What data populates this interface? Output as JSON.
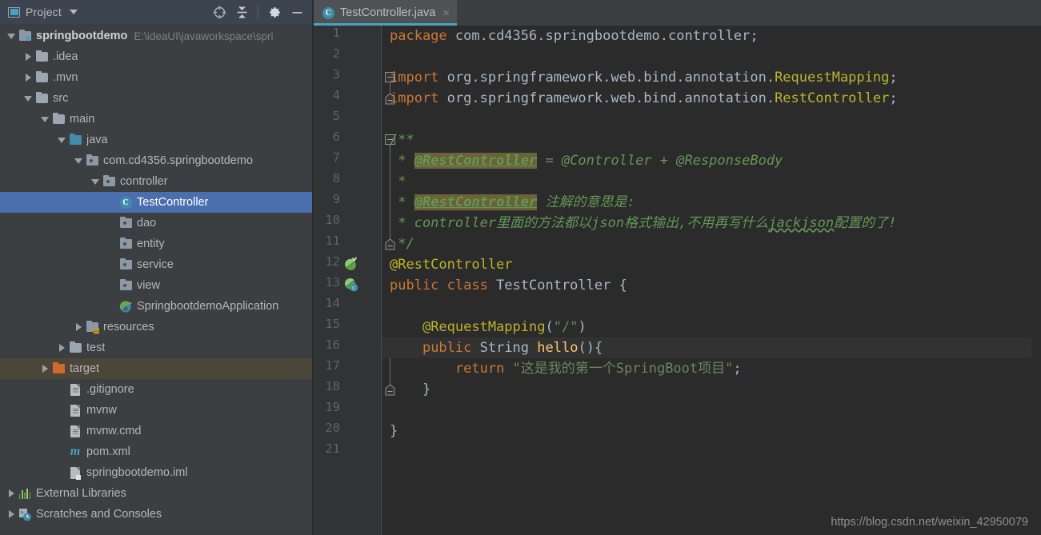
{
  "app": {
    "theme_bg": "#3c3f41",
    "editor_bg": "#2b2b2b",
    "accent": "#4b6eaf"
  },
  "project_panel": {
    "title": "Project",
    "caret_icon": "chevron-down-icon",
    "tools": [
      {
        "name": "locate-target-icon",
        "title": "Select Opened File"
      },
      {
        "name": "collapse-all-icon",
        "title": "Collapse All"
      },
      {
        "name": "gear-icon",
        "title": "Settings"
      },
      {
        "name": "minimize-icon",
        "title": "Hide"
      }
    ],
    "tree": [
      {
        "label": "springbootdemo",
        "secondary": "E:\\ideaUI\\javaworkspace\\spri",
        "indent": 0,
        "twisty": "down",
        "icon": "module-folder-icon",
        "bold": true,
        "state": "normal"
      },
      {
        "label": ".idea",
        "secondary": "",
        "indent": 1,
        "twisty": "right",
        "icon": "folder-icon",
        "bold": false,
        "state": "normal"
      },
      {
        "label": ".mvn",
        "secondary": "",
        "indent": 1,
        "twisty": "right",
        "icon": "folder-icon",
        "bold": false,
        "state": "normal"
      },
      {
        "label": "src",
        "secondary": "",
        "indent": 1,
        "twisty": "down",
        "icon": "folder-icon",
        "bold": false,
        "state": "normal"
      },
      {
        "label": "main",
        "secondary": "",
        "indent": 2,
        "twisty": "down",
        "icon": "folder-icon",
        "bold": false,
        "state": "normal"
      },
      {
        "label": "java",
        "secondary": "",
        "indent": 3,
        "twisty": "down",
        "icon": "source-root-icon",
        "bold": false,
        "state": "normal"
      },
      {
        "label": "com.cd4356.springbootdemo",
        "secondary": "",
        "indent": 4,
        "twisty": "down",
        "icon": "package-icon",
        "bold": false,
        "state": "normal"
      },
      {
        "label": "controller",
        "secondary": "",
        "indent": 5,
        "twisty": "down",
        "icon": "package-icon",
        "bold": false,
        "state": "normal"
      },
      {
        "label": "TestController",
        "secondary": "",
        "indent": 6,
        "twisty": "none",
        "icon": "java-class-icon",
        "bold": false,
        "state": "selected"
      },
      {
        "label": "dao",
        "secondary": "",
        "indent": 6,
        "twisty": "none",
        "icon": "package-icon",
        "bold": false,
        "state": "normal"
      },
      {
        "label": "entity",
        "secondary": "",
        "indent": 6,
        "twisty": "none",
        "icon": "package-icon",
        "bold": false,
        "state": "normal"
      },
      {
        "label": "service",
        "secondary": "",
        "indent": 6,
        "twisty": "none",
        "icon": "package-icon",
        "bold": false,
        "state": "normal"
      },
      {
        "label": "view",
        "secondary": "",
        "indent": 6,
        "twisty": "none",
        "icon": "package-icon",
        "bold": false,
        "state": "normal"
      },
      {
        "label": "SpringbootdemoApplication",
        "secondary": "",
        "indent": 6,
        "twisty": "none",
        "icon": "spring-boot-class-icon",
        "bold": false,
        "state": "normal"
      },
      {
        "label": "resources",
        "secondary": "",
        "indent": 4,
        "twisty": "right",
        "icon": "resources-folder-icon",
        "bold": false,
        "state": "normal"
      },
      {
        "label": "test",
        "secondary": "",
        "indent": 3,
        "twisty": "right",
        "icon": "folder-icon",
        "bold": false,
        "state": "normal"
      },
      {
        "label": "target",
        "secondary": "",
        "indent": 2,
        "twisty": "right",
        "icon": "excluded-folder-icon",
        "bold": false,
        "state": "highlight"
      },
      {
        "label": ".gitignore",
        "secondary": "",
        "indent": 3,
        "twisty": "none",
        "icon": "text-file-icon",
        "bold": false,
        "state": "normal"
      },
      {
        "label": "mvnw",
        "secondary": "",
        "indent": 3,
        "twisty": "none",
        "icon": "text-file-icon",
        "bold": false,
        "state": "normal"
      },
      {
        "label": "mvnw.cmd",
        "secondary": "",
        "indent": 3,
        "twisty": "none",
        "icon": "text-file-icon",
        "bold": false,
        "state": "normal"
      },
      {
        "label": "pom.xml",
        "secondary": "",
        "indent": 3,
        "twisty": "none",
        "icon": "maven-pom-icon",
        "bold": false,
        "state": "normal"
      },
      {
        "label": "springbootdemo.iml",
        "secondary": "",
        "indent": 3,
        "twisty": "none",
        "icon": "iml-file-icon",
        "bold": false,
        "state": "normal"
      },
      {
        "label": "External Libraries",
        "secondary": "",
        "indent": 0,
        "twisty": "right",
        "icon": "libraries-icon",
        "bold": false,
        "state": "normal"
      },
      {
        "label": "Scratches and Consoles",
        "secondary": "",
        "indent": 0,
        "twisty": "right",
        "icon": "scratches-icon",
        "bold": false,
        "state": "normal"
      }
    ]
  },
  "editor": {
    "tabs": [
      {
        "label": "TestController.java",
        "icon": "java-class-icon",
        "close_icon": "×",
        "active": true
      }
    ],
    "line_numbers": [
      1,
      2,
      3,
      4,
      5,
      6,
      7,
      8,
      9,
      10,
      11,
      12,
      13,
      14,
      15,
      16,
      17,
      18,
      19,
      20,
      21
    ],
    "current_line": 16,
    "gutter_icons": [
      {
        "line": 12,
        "name": "spring-bean-icon"
      },
      {
        "line": 13,
        "name": "spring-bean-class-icon"
      }
    ],
    "lines": [
      {
        "n": 1,
        "tokens": [
          {
            "t": "package ",
            "c": "kw"
          },
          {
            "t": "com.cd4356.springbootdemo.controller;",
            "c": "pl"
          }
        ]
      },
      {
        "n": 2,
        "tokens": []
      },
      {
        "n": 3,
        "tokens": [
          {
            "t": "import ",
            "c": "kw"
          },
          {
            "t": "org.springframework.web.bind.annotation.",
            "c": "pl"
          },
          {
            "t": "RequestMapping",
            "c": "an"
          },
          {
            "t": ";",
            "c": "pl"
          }
        ]
      },
      {
        "n": 4,
        "tokens": [
          {
            "t": "import ",
            "c": "kw"
          },
          {
            "t": "org.springframework.web.bind.annotation.",
            "c": "pl"
          },
          {
            "t": "RestController",
            "c": "an"
          },
          {
            "t": ";",
            "c": "pl"
          }
        ]
      },
      {
        "n": 5,
        "tokens": []
      },
      {
        "n": 6,
        "tokens": [
          {
            "t": "/**",
            "c": "cm"
          }
        ]
      },
      {
        "n": 7,
        "tokens": [
          {
            "t": " * ",
            "c": "cm"
          },
          {
            "t": "@RestController",
            "c": "cmh"
          },
          {
            "t": " = @Controller + @ResponseBody",
            "c": "cm"
          }
        ]
      },
      {
        "n": 8,
        "tokens": [
          {
            "t": " *",
            "c": "cm"
          }
        ]
      },
      {
        "n": 9,
        "tokens": [
          {
            "t": " * ",
            "c": "cm"
          },
          {
            "t": "@RestController",
            "c": "cmh"
          },
          {
            "t": " 注解的意思是:",
            "c": "cm"
          }
        ]
      },
      {
        "n": 10,
        "tokens": [
          {
            "t": " * controller里面的方法都以json格式输出,不用再写什么",
            "c": "cm"
          },
          {
            "t": "jackjson",
            "c": "cm typo"
          },
          {
            "t": "配置的了!",
            "c": "cm"
          }
        ]
      },
      {
        "n": 11,
        "tokens": [
          {
            "t": " */",
            "c": "cm"
          }
        ]
      },
      {
        "n": 12,
        "tokens": [
          {
            "t": "@RestController",
            "c": "an"
          }
        ]
      },
      {
        "n": 13,
        "tokens": [
          {
            "t": "public class ",
            "c": "kw"
          },
          {
            "t": "TestController {",
            "c": "pl"
          }
        ]
      },
      {
        "n": 14,
        "tokens": []
      },
      {
        "n": 15,
        "tokens": [
          {
            "t": "    ",
            "c": "pl"
          },
          {
            "t": "@RequestMapping",
            "c": "an"
          },
          {
            "t": "(",
            "c": "pl"
          },
          {
            "t": "\"/\"",
            "c": "str"
          },
          {
            "t": ")",
            "c": "pl"
          }
        ]
      },
      {
        "n": 16,
        "tokens": [
          {
            "t": "    ",
            "c": "pl"
          },
          {
            "t": "public ",
            "c": "kw"
          },
          {
            "t": "String ",
            "c": "pl"
          },
          {
            "t": "hello",
            "c": "mth"
          },
          {
            "t": "(){",
            "c": "pl"
          }
        ]
      },
      {
        "n": 17,
        "tokens": [
          {
            "t": "        ",
            "c": "pl"
          },
          {
            "t": "return ",
            "c": "kw"
          },
          {
            "t": "\"这是我的第一个SpringBoot项目\"",
            "c": "str"
          },
          {
            "t": ";",
            "c": "pl"
          }
        ]
      },
      {
        "n": 18,
        "tokens": [
          {
            "t": "    }",
            "c": "pl"
          }
        ]
      },
      {
        "n": 19,
        "tokens": []
      },
      {
        "n": 20,
        "tokens": [
          {
            "t": "}",
            "c": "pl"
          }
        ]
      },
      {
        "n": 21,
        "tokens": []
      }
    ],
    "folding": [
      {
        "type": "minus",
        "line": 3
      },
      {
        "type": "cap-bottom",
        "line": 4
      },
      {
        "type": "minus",
        "line": 6
      },
      {
        "type": "cap-bottom",
        "line": 11
      },
      {
        "type": "minus",
        "line": 16
      },
      {
        "type": "cap-bottom",
        "line": 18
      }
    ],
    "watermark": "https://blog.csdn.net/weixin_42950079"
  }
}
